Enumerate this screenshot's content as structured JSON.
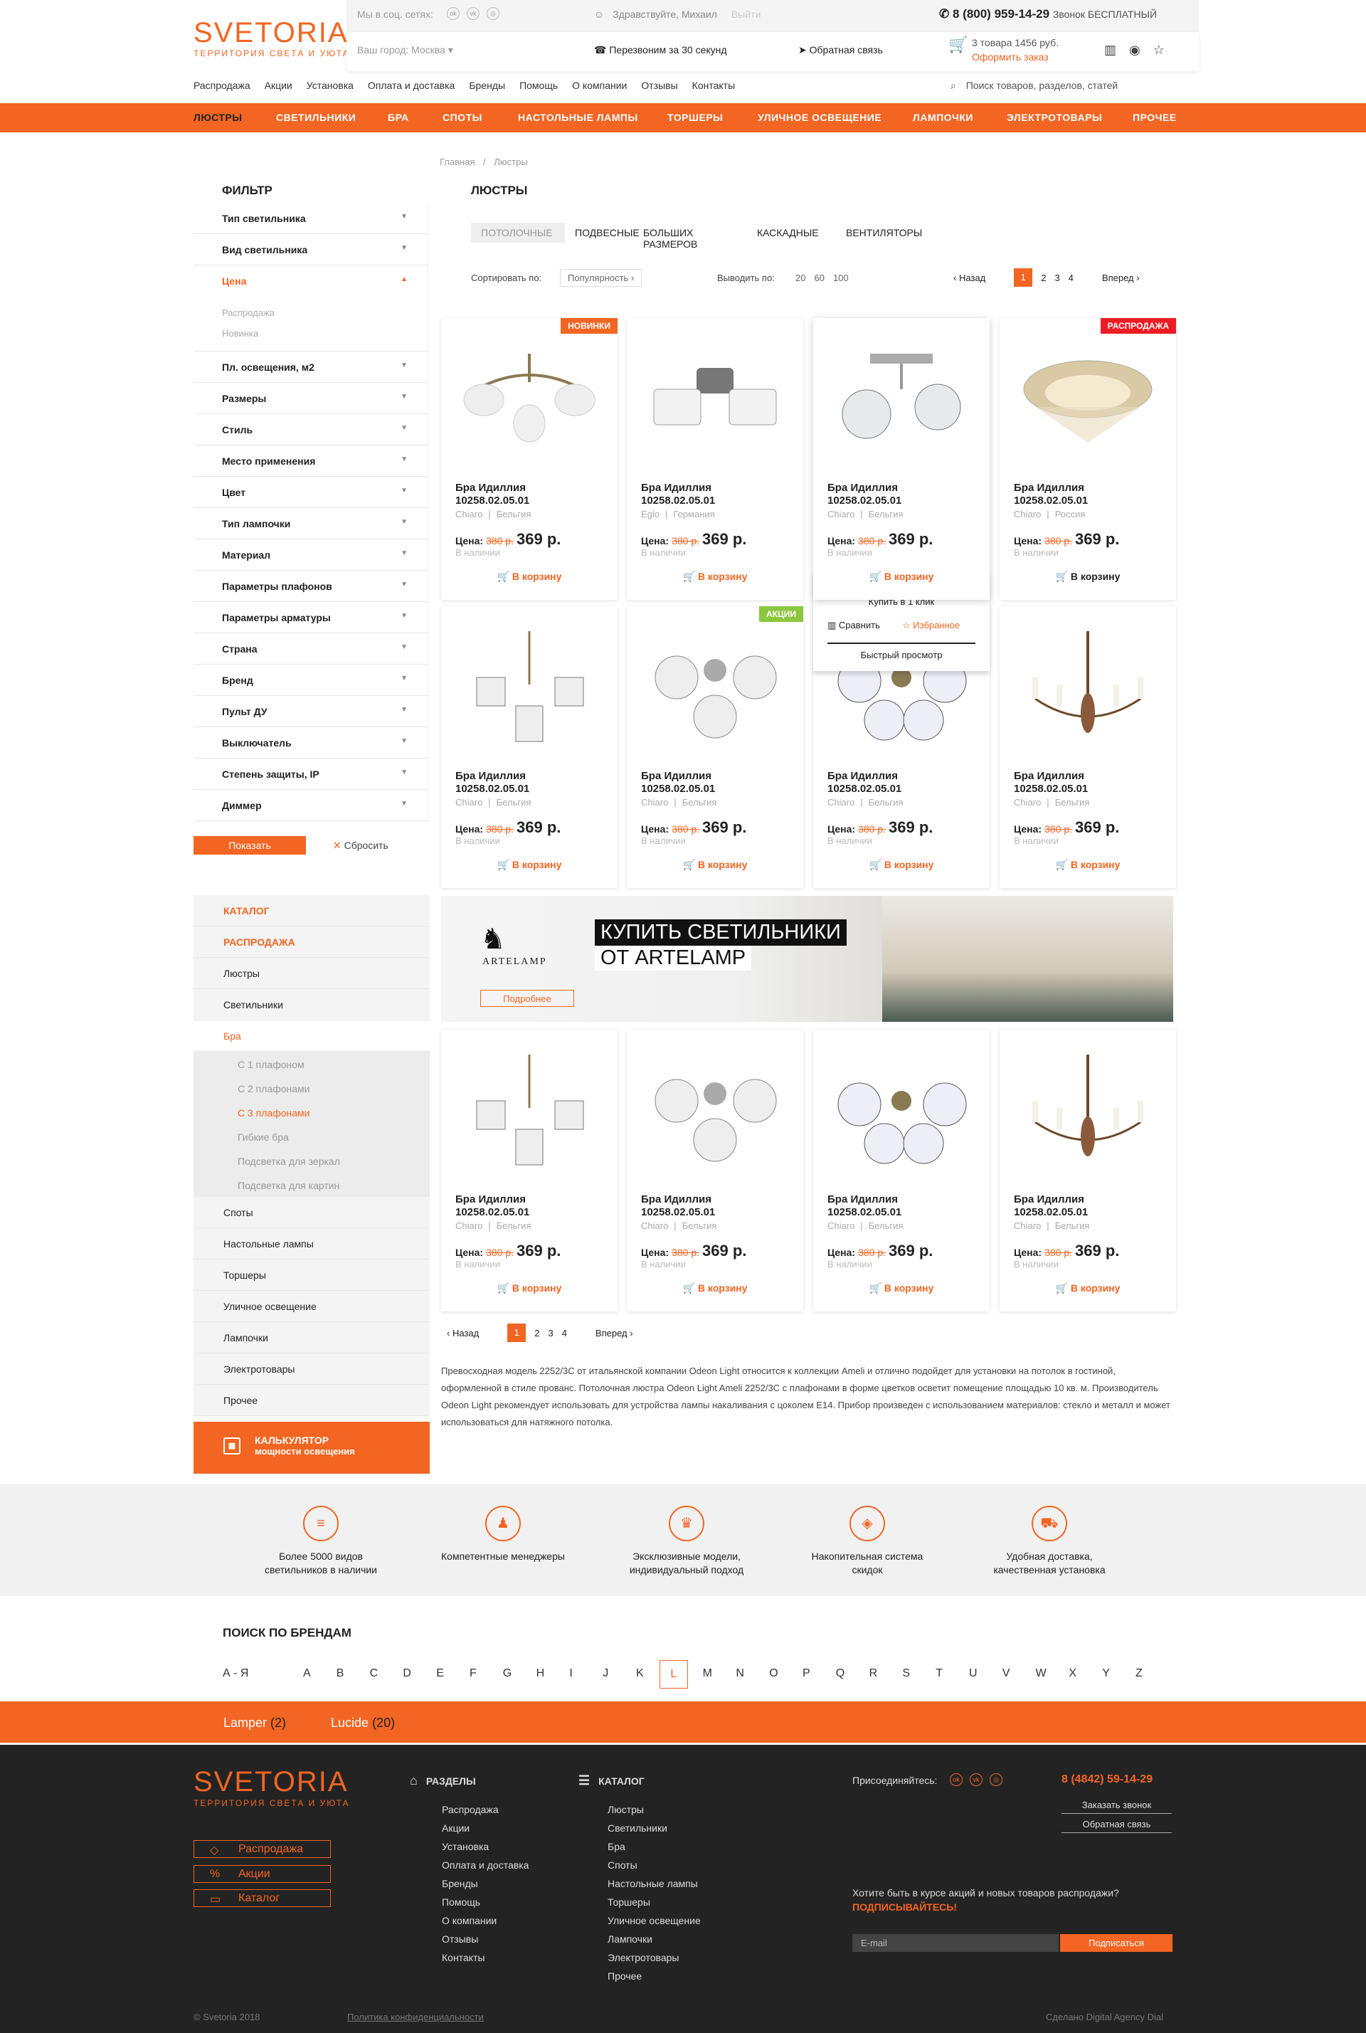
{
  "header": {
    "logo_main": "SVETORIA",
    "logo_sub": "ТЕРРИТОРИЯ СВЕТА И УЮТА",
    "social_label": "Мы в соц. сетях:",
    "greeting": "Здравствуйте, Михаил",
    "logout": "Выйти",
    "phone": "8 (800) 959-14-29",
    "phone_note": "Звонок БЕСПЛАТНЫЙ",
    "city": "Ваш город: Москва",
    "callback": "Перезвоним за 30 секунд",
    "feedback": "Обратная связь",
    "cart_info": "3 товара 1456 руб.",
    "cart_link": "Оформить заказ"
  },
  "top_nav": [
    "Распродажа",
    "Акции",
    "Установка",
    "Оплата и доставка",
    "Бренды",
    "Помощь",
    "О компании",
    "Отзывы",
    "Контакты"
  ],
  "search_placeholder": "Поиск товаров, разделов, статей",
  "main_nav": [
    "Люстры",
    "Светильники",
    "Бра",
    "Споты",
    "Настольные лампы",
    "Торшеры",
    "Уличное освещение",
    "Лампочки",
    "Электротовары",
    "Прочее"
  ],
  "breadcrumb": [
    "Главная",
    "/",
    "Люстры"
  ],
  "page_title": "ЛЮСТРЫ",
  "filter": {
    "title": "ФИЛЬТР",
    "items": [
      "Тип светильника",
      "Вид светильника",
      "Цена",
      "Пл. освещения, м2",
      "Размеры",
      "Стиль",
      "Место применения",
      "Цвет",
      "Тип лампочки",
      "Материал",
      "Параметры плафонов",
      "Параметры арматуры",
      "Страна",
      "Бренд",
      "Пульт ДУ",
      "Выключатель",
      "Степень защиты, IP",
      "Диммер"
    ],
    "price_sub": [
      "Распродажа",
      "Новинка"
    ],
    "show": "Показать",
    "reset": "Сбросить"
  },
  "subtabs": [
    "ПОТОЛОЧНЫЕ",
    "ПОДВЕСНЫЕ",
    "БОЛЬШИХ РАЗМЕРОВ",
    "КАСКАДНЫЕ",
    "ВЕНТИЛЯТОРЫ"
  ],
  "sort": {
    "label": "Сортировать по:",
    "value": "Популярность",
    "show_label": "Выводить по:",
    "counts": [
      "20",
      "60",
      "100"
    ]
  },
  "pager": {
    "prev": "Назад",
    "pages": [
      "1",
      "2",
      "3",
      "4"
    ],
    "next": "Вперед"
  },
  "card": {
    "title1": "Бра Идиллия",
    "title2": "10258.02.05.01",
    "price_label": "Цена:",
    "old": "380 р.",
    "new": "369 р.",
    "avail": "В наличии",
    "cart": "В корзину",
    "sep": "|"
  },
  "cards_row1": [
    {
      "brand": "Chiaro",
      "country": "Бельгия",
      "badge": "НОВИНКИ"
    },
    {
      "brand": "Eglo",
      "country": "Германия",
      "badge": ""
    },
    {
      "brand": "Chiaro",
      "country": "Бельгия",
      "badge": ""
    },
    {
      "brand": "Chiaro",
      "country": "Россия",
      "badge": "РАСПРОДАЖА"
    }
  ],
  "cards_row2": [
    {
      "brand": "Chiaro",
      "country": "Бельгия",
      "badge": ""
    },
    {
      "brand": "Chiaro",
      "country": "Бельгия",
      "badge": "АКЦИИ"
    },
    {
      "brand": "Chiaro",
      "country": "Бельгия",
      "badge": ""
    },
    {
      "brand": "Chiaro",
      "country": "Бельгия",
      "badge": ""
    }
  ],
  "cards_row3": [
    {
      "brand": "Chiaro",
      "country": "Бельгия"
    },
    {
      "brand": "Chiaro",
      "country": "Бельгия"
    },
    {
      "brand": "Chiaro",
      "country": "Бельгия"
    },
    {
      "brand": "Chiaro",
      "country": "Бельгия"
    }
  ],
  "hover": {
    "buy1": "Купить в 1 клик",
    "compare": "Сравнить",
    "fav": "Избранное",
    "quick": "Быстрый просмотр"
  },
  "sidecat": {
    "items": [
      "КАТАЛОГ",
      "РАСПРОДАЖА",
      "Люстры",
      "Светильники",
      "Бра"
    ],
    "sub": [
      "С 1 плафоном",
      "С 2 плафонами",
      "С 3 плафонами",
      "Гибкие бра",
      "Подсветка для зеркал",
      "Подсветка для картин"
    ],
    "items2": [
      "Споты",
      "Настольные лампы",
      "Торшеры",
      "Уличное освещение",
      "Лампочки",
      "Электротовары",
      "Прочее"
    ],
    "calc1": "КАЛЬКУЛЯТОР",
    "calc2": "мощности освещения"
  },
  "banner": {
    "brand": "ARTELAMP",
    "line1": "КУПИТЬ СВЕТИЛЬНИКИ",
    "line2": "ОТ ARTELAMP",
    "more": "Подробнее"
  },
  "description": "Превосходная модель 2252/3C от итальянской компании Odeon Light относится к коллекции Ameli и отлично подойдет для установки на потолок в гостиной, оформленной в стиле прованс. Потолочная люстра Odeon Light Ameli 2252/3C с плафонами в форме цветков осветит помещение площадью 10 кв. м. Производитель Odeon Light рекомендует использовать для устройства лампы накаливания с цоколем E14. Прибор произведен с использованием материалов: стекло и металл и может использоваться для натяжного потолка.",
  "advantages": [
    {
      "l1": "Более 5000 видов",
      "l2": "светильников в наличии"
    },
    {
      "l1": "Компетентные менеджеры",
      "l2": ""
    },
    {
      "l1": "Эксклюзивные модели,",
      "l2": "индивидуальный подход"
    },
    {
      "l1": "Накопительная система",
      "l2": "скидок"
    },
    {
      "l1": "Удобная доставка,",
      "l2": "качественная установка"
    }
  ],
  "brands": {
    "title": "ПОИСК ПО БРЕНДАМ",
    "letters": [
      "А - Я",
      "A",
      "B",
      "C",
      "D",
      "E",
      "F",
      "G",
      "H",
      "I",
      "J",
      "K",
      "L",
      "M",
      "N",
      "O",
      "P",
      "Q",
      "R",
      "S",
      "T",
      "U",
      "V",
      "W",
      "X",
      "Y",
      "Z"
    ],
    "found": [
      {
        "name": "Lamper",
        "count": "(2)"
      },
      {
        "name": "Lucide",
        "count": "(20)"
      }
    ]
  },
  "footer": {
    "sections_title": "РАЗДЕЛЫ",
    "sections": [
      "Распродажа",
      "Акции",
      "Установка",
      "Оплата и доставка",
      "Бренды",
      "Помощь",
      "О компании",
      "Отзывы",
      "Контакты"
    ],
    "catalog_title": "КАТАЛОГ",
    "catalog": [
      "Люстры",
      "Светильники",
      "Бра",
      "Споты",
      "Настольные лампы",
      "Торшеры",
      "Уличное освещение",
      "Лампочки",
      "Электротовары",
      "Прочее"
    ],
    "join": "Присоединяйтесь:",
    "phone": "8 (4842) 59-14-29",
    "order_call": "Заказать звонок",
    "feedback": "Обратная связь",
    "sub_q": "Хотите быть в курсе акций и новых товаров распродажи?",
    "sub_cta": "ПОДПИСЫВАЙТЕСЬ!",
    "email_ph": "E-mail",
    "subscribe": "Подписаться",
    "btns": [
      "Распродажа",
      "Акции",
      "Каталог"
    ],
    "copy": "© Svetoria 2018",
    "policy": "Политика конфиденциальности",
    "made": "Сделано Digital Agency Dial"
  },
  "colors": {
    "accent": "#f26522",
    "green": "#8dc63f",
    "red": "#ed1c24",
    "dark": "#232323"
  }
}
